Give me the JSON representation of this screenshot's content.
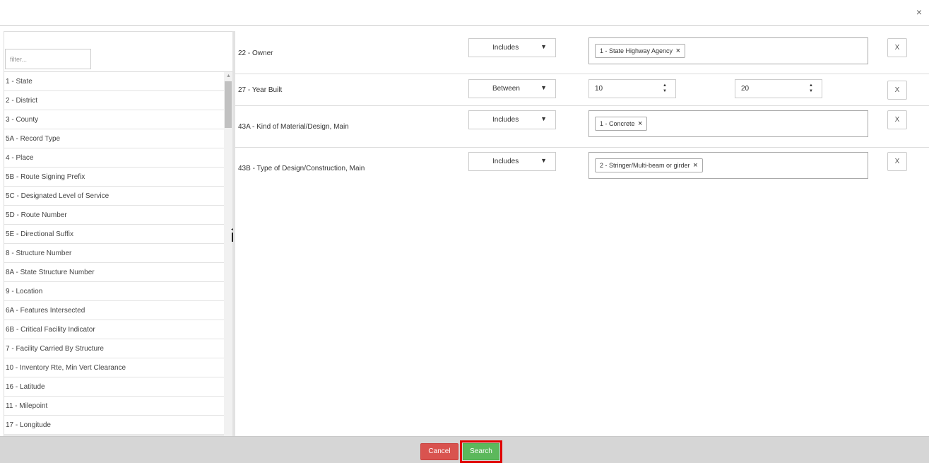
{
  "dialog": {
    "close_label": "×"
  },
  "filter": {
    "placeholder": "filter..."
  },
  "fields": [
    "1 - State",
    "2 - District",
    "3 - County",
    "5A - Record Type",
    "4 - Place",
    "5B - Route Signing Prefix",
    "5C - Designated Level of Service",
    "5D - Route Number",
    "5E - Directional Suffix",
    "8 - Structure Number",
    "8A - State Structure Number",
    "9 - Location",
    "6A - Features Intersected",
    "6B - Critical Facility Indicator",
    "7 - Facility Carried By Structure",
    "10 - Inventory Rte, Min Vert Clearance",
    "16 - Latitude",
    "11 - Milepoint",
    "17 - Longitude"
  ],
  "criteria": [
    {
      "label": "22 - Owner",
      "operator": "Includes",
      "caret": "▼",
      "tag": "1 - State Highway Agency",
      "tag_remove": "×",
      "remove_label": "X"
    },
    {
      "label": "27 - Year Built",
      "operator": "Between",
      "caret": "▼",
      "from": "10",
      "to": "20",
      "spin": "▲\n▼",
      "remove_label": "X"
    },
    {
      "label": "43A - Kind of Material/Design, Main",
      "operator": "Includes",
      "caret": "▼",
      "tag": "1 - Concrete",
      "tag_remove": "×",
      "remove_label": "X"
    },
    {
      "label": "43B - Type of Design/Construction, Main",
      "operator": "Includes",
      "caret": "▼",
      "tag": "2 - Stringer/Multi-beam or girder",
      "tag_remove": "×",
      "remove_label": "X"
    }
  ],
  "footer": {
    "cancel_label": "Cancel",
    "search_label": "Search"
  },
  "colors": {
    "cancel": "#d9534f",
    "search": "#5cb85c",
    "highlight": "#e00000"
  }
}
